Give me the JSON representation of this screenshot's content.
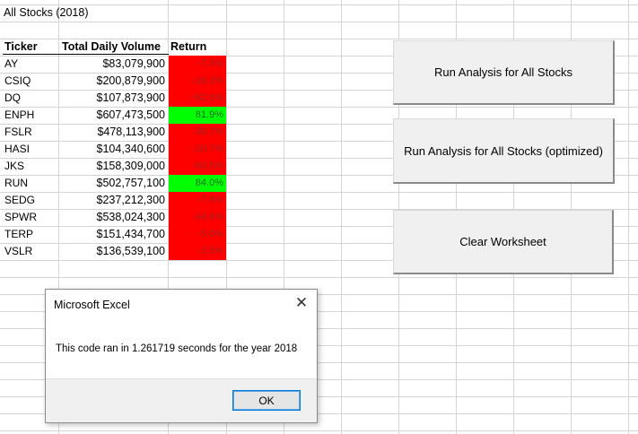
{
  "sheet_title": "All Stocks (2018)",
  "headers": {
    "ticker": "Ticker",
    "volume": "Total Daily Volume",
    "return": "Return"
  },
  "rows": [
    {
      "ticker": "AY",
      "volume": "$83,079,900",
      "return": "-7.3%",
      "status": "negative"
    },
    {
      "ticker": "CSIQ",
      "volume": "$200,879,900",
      "return": "-16.3%",
      "status": "negative"
    },
    {
      "ticker": "DQ",
      "volume": "$107,873,900",
      "return": "-62.6%",
      "status": "negative"
    },
    {
      "ticker": "ENPH",
      "volume": "$607,473,500",
      "return": "81.9%",
      "status": "positive"
    },
    {
      "ticker": "FSLR",
      "volume": "$478,113,900",
      "return": "-39.7%",
      "status": "negative"
    },
    {
      "ticker": "HASI",
      "volume": "$104,340,600",
      "return": "-20.7%",
      "status": "negative"
    },
    {
      "ticker": "JKS",
      "volume": "$158,309,000",
      "return": "-60.5%",
      "status": "negative"
    },
    {
      "ticker": "RUN",
      "volume": "$502,757,100",
      "return": "84.0%",
      "status": "positive"
    },
    {
      "ticker": "SEDG",
      "volume": "$237,212,300",
      "return": "-7.8%",
      "status": "negative"
    },
    {
      "ticker": "SPWR",
      "volume": "$538,024,300",
      "return": "-44.6%",
      "status": "negative"
    },
    {
      "ticker": "TERP",
      "volume": "$151,434,700",
      "return": "-5.0%",
      "status": "negative"
    },
    {
      "ticker": "VSLR",
      "volume": "$136,539,100",
      "return": "-3.5%",
      "status": "negative"
    }
  ],
  "colors": {
    "positive": "#00ff00",
    "negative": "#ff0000"
  },
  "buttons": {
    "run_all": "Run Analysis for All Stocks",
    "run_optimized": "Run Analysis for All Stocks (optimized)",
    "clear": "Clear Worksheet"
  },
  "dialog": {
    "title": "Microsoft Excel",
    "message": "This code ran in 1.261719 seconds for the year 2018",
    "ok_label": "OK",
    "close_icon": "close-icon"
  }
}
